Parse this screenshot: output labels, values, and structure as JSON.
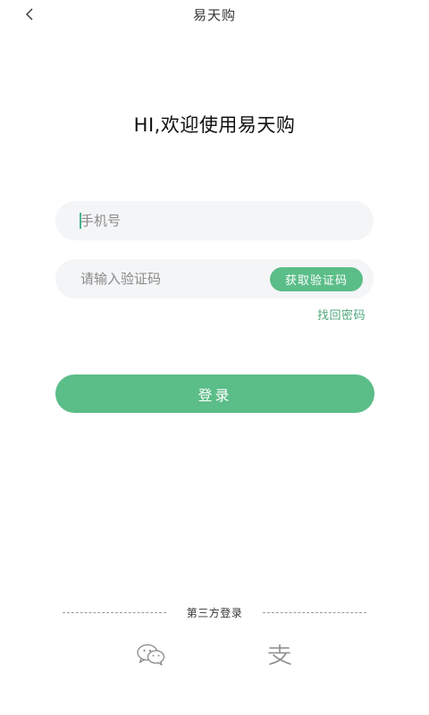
{
  "header": {
    "title": "易天购",
    "back_icon": "chevron-left-icon"
  },
  "welcome_text": "HI,欢迎使用易天购",
  "phone_input": {
    "placeholder": "手机号",
    "value": ""
  },
  "code_input": {
    "placeholder": "请输入验证码",
    "value": ""
  },
  "get_code_button": "获取验证码",
  "forgot_password": "找回密码",
  "login_button": "登录",
  "third_party": {
    "label": "第三方登录",
    "icons": [
      "wechat-icon",
      "alipay-icon"
    ]
  },
  "colors": {
    "accent": "#5bbd88",
    "link": "#4fa77c",
    "input_bg": "#f4f5f7"
  }
}
